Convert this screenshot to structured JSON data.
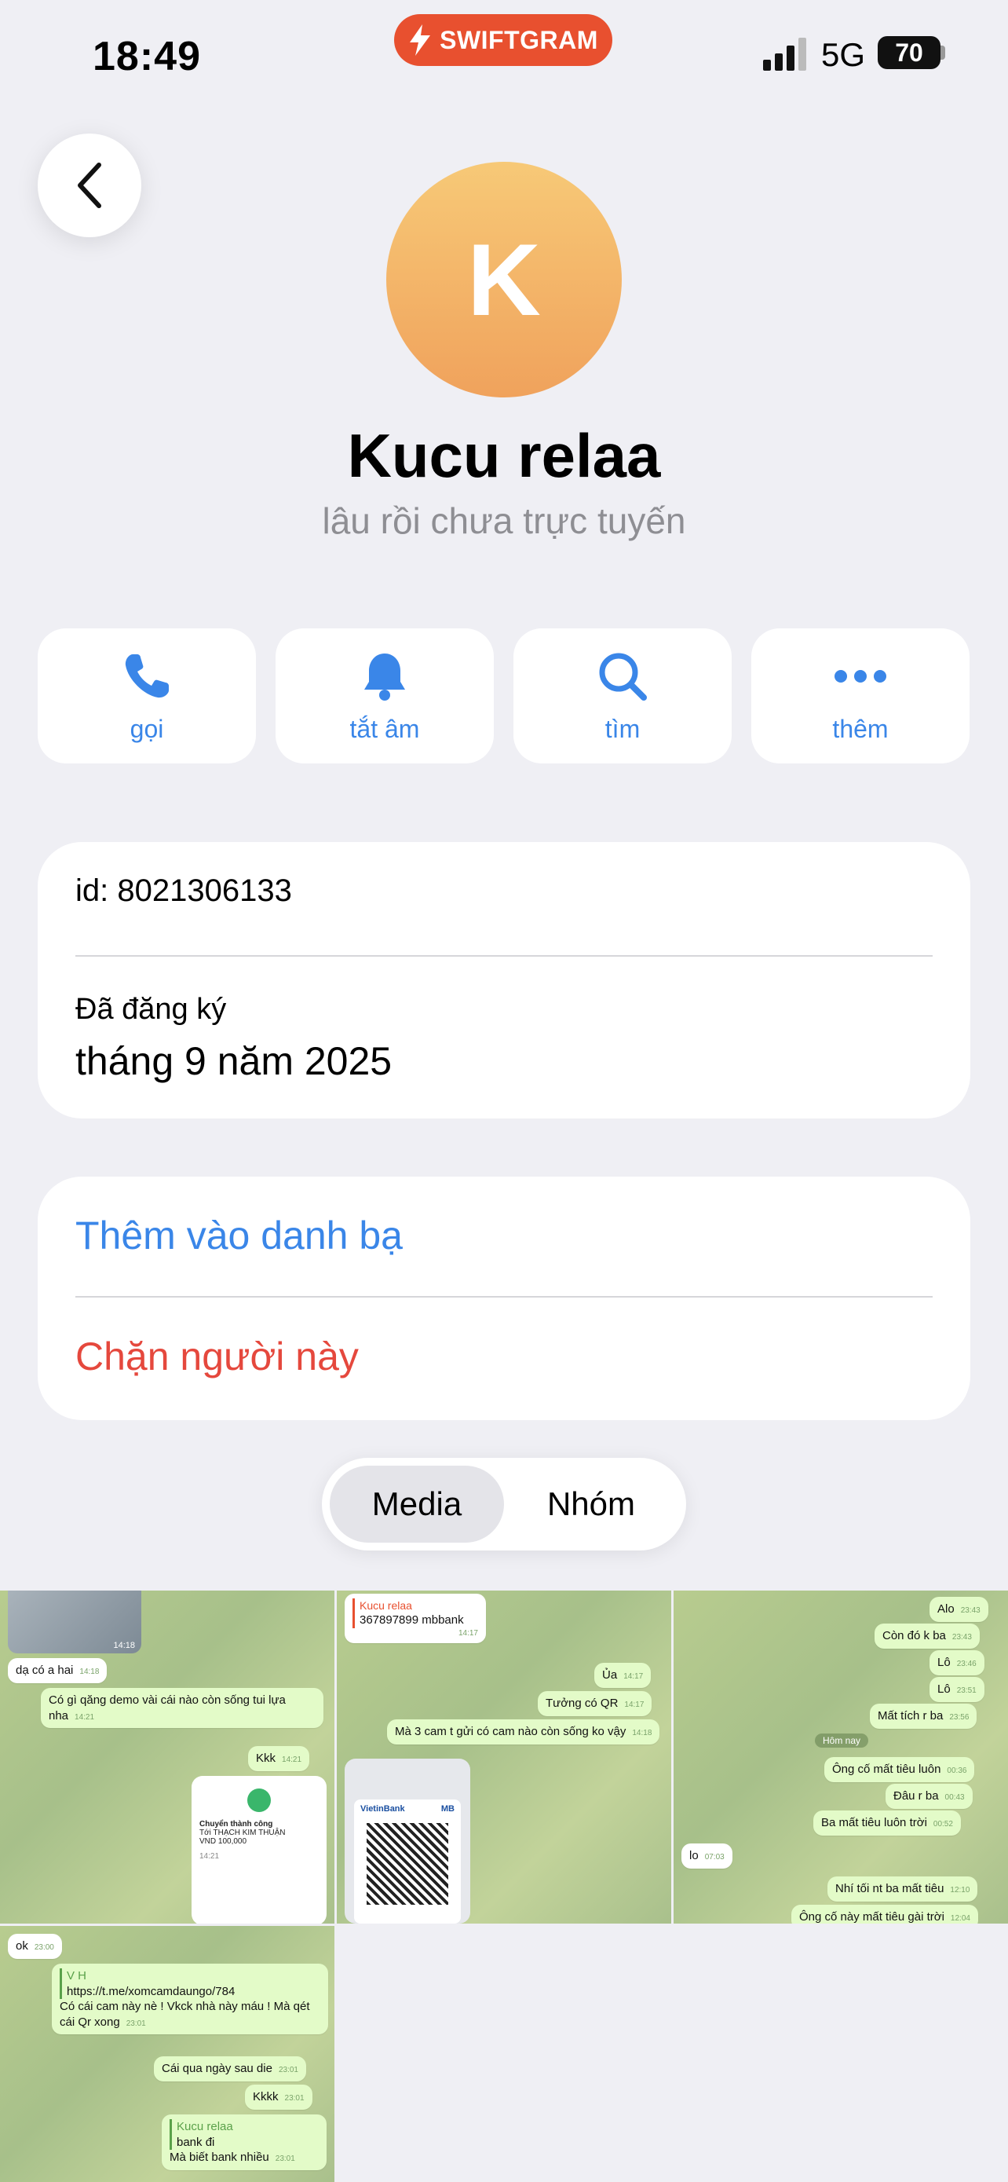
{
  "status_bar": {
    "time": "18:49",
    "network": "5G",
    "battery": "70",
    "brand": "SWIFTGRAM"
  },
  "profile": {
    "avatar_letter": "K",
    "name": "Kucu relaa",
    "presence": "lâu rồi chưa trực tuyến"
  },
  "actions": [
    {
      "label": "gọi",
      "icon": "phone-icon"
    },
    {
      "label": "tắt âm",
      "icon": "bell-icon"
    },
    {
      "label": "tìm",
      "icon": "search-icon"
    },
    {
      "label": "thêm",
      "icon": "more-icon"
    }
  ],
  "info": {
    "id_text": "id: 8021306133",
    "registered_label": "Đã đăng ký",
    "registered_value": "tháng 9 năm 2025"
  },
  "contact_actions": {
    "add": "Thêm vào danh bạ",
    "block": "Chặn người này"
  },
  "tabs": {
    "media": "Media",
    "groups": "Nhóm"
  },
  "media": {
    "t1": {
      "m1": "dạ có a hai",
      "m1t": "14:18",
      "img_t": "14:18",
      "m2": "Có gì qăng demo vài cái nào còn sống tui lựa nha",
      "m2t": "14:21",
      "m3": "Kkk",
      "m3t": "14:21",
      "receipt_title": "Chuyển thành công",
      "receipt_to": "Tới THẠCH KIM THUẬN",
      "receipt_amount": "VND 100,000",
      "receipt_time": "14:21"
    },
    "t2": {
      "reply_name": "Kucu relaa",
      "reply_text": "367897899 mbbank",
      "reply_t": "14:17",
      "m1": "Ủa",
      "m1t": "14:17",
      "m2": "Tưởng có QR",
      "m2t": "14:17",
      "m3": "Mà 3 cam t gửi có cam nào còn sống ko vậy",
      "m3t": "14:18",
      "bank1": "VietinBank",
      "bank2": "MB"
    },
    "t3": {
      "m1": "Alo",
      "m1t": "23:43",
      "m2": "Còn đó k ba",
      "m2t": "23:43",
      "m3": "Lô",
      "m3t": "23:46",
      "m4": "Lô",
      "m4t": "23:51",
      "m5": "Mất tích r ba",
      "m5t": "23:56",
      "day": "Hôm nay",
      "m6": "Ông cố mất tiêu luôn",
      "m6t": "00:36",
      "m7": "Đâu r ba",
      "m7t": "00:43",
      "m8": "Ba mất tiêu luôn trời",
      "m8t": "00:52",
      "in1": "lo",
      "in1t": "07:03",
      "m9": "Nhí tối nt ba mất tiêu",
      "m9t": "12:10",
      "m10": "Ông cố này mất tiêu gài trời",
      "m10t": "12:04"
    },
    "t4": {
      "in1": "ok",
      "in1t": "23:00",
      "fwd_name": "V H",
      "link": "https://t.me/xomcamdaungo/784",
      "m1": "Có cái cam này nè ! Vkck nhà này máu ! Mà qét cái Qr xong",
      "m1t": "23:01",
      "m2": "Cái qua ngày sau die",
      "m2t": "23:01",
      "m3": "Kkkk",
      "m3t": "23:01",
      "reply_name": "Kucu relaa",
      "reply_text": "bank đi",
      "m4": "Mà biết bank nhiều",
      "m4t": "23:01"
    }
  },
  "colors": {
    "accent": "#3a86e8",
    "danger": "#e5483d",
    "brand": "#e8502f",
    "avatar": "#f0a25c"
  }
}
